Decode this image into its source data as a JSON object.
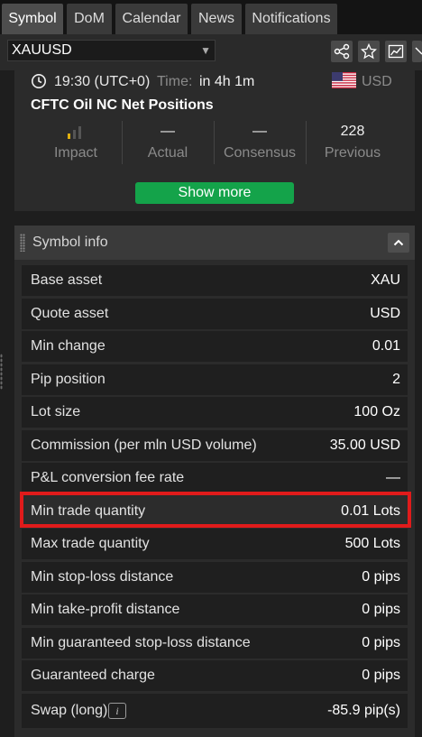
{
  "tabs": [
    "Symbol",
    "DoM",
    "Calendar",
    "News",
    "Notifications"
  ],
  "symbol_select": {
    "value": "XAUUSD"
  },
  "toolbar_icons": [
    "share-icon",
    "star-icon",
    "chart-icon",
    "close-icon"
  ],
  "event": {
    "time": "19:30 (UTC+0)",
    "time_label": "Time:",
    "time_value": "in 4h 1m",
    "currency": "USD",
    "title": "CFTC Oil NC Net Positions",
    "stats": [
      {
        "value": "",
        "label": "Impact"
      },
      {
        "value": "—",
        "label": "Actual"
      },
      {
        "value": "—",
        "label": "Consensus"
      },
      {
        "value": "228",
        "label": "Previous"
      }
    ],
    "impact_level": 1,
    "show_more": "Show more"
  },
  "symbol_info": {
    "title": "Symbol info",
    "rows": [
      {
        "key": "Base asset",
        "value": "XAU"
      },
      {
        "key": "Quote asset",
        "value": "USD"
      },
      {
        "key": "Min change",
        "value": "0.01"
      },
      {
        "key": "Pip position",
        "value": "2"
      },
      {
        "key": "Lot size",
        "value": "100 Oz"
      },
      {
        "key": "Commission (per mln USD volume)",
        "value": "35.00 USD"
      },
      {
        "key": "P&L conversion fee rate",
        "value": "—"
      },
      {
        "key": "Min trade quantity",
        "value": "0.01 Lots"
      },
      {
        "key": "Max trade quantity",
        "value": "500 Lots"
      },
      {
        "key": "Min stop-loss distance",
        "value": "0 pips"
      },
      {
        "key": "Min take-profit distance",
        "value": "0 pips"
      },
      {
        "key": "Min guaranteed stop-loss distance",
        "value": "0 pips"
      },
      {
        "key": "Guaranteed charge",
        "value": "0 pips"
      },
      {
        "key": "Swap (long)",
        "value": "-85.9 pip(s)",
        "info_icon": "i"
      }
    ]
  },
  "highlight_color": "#e01b1b"
}
